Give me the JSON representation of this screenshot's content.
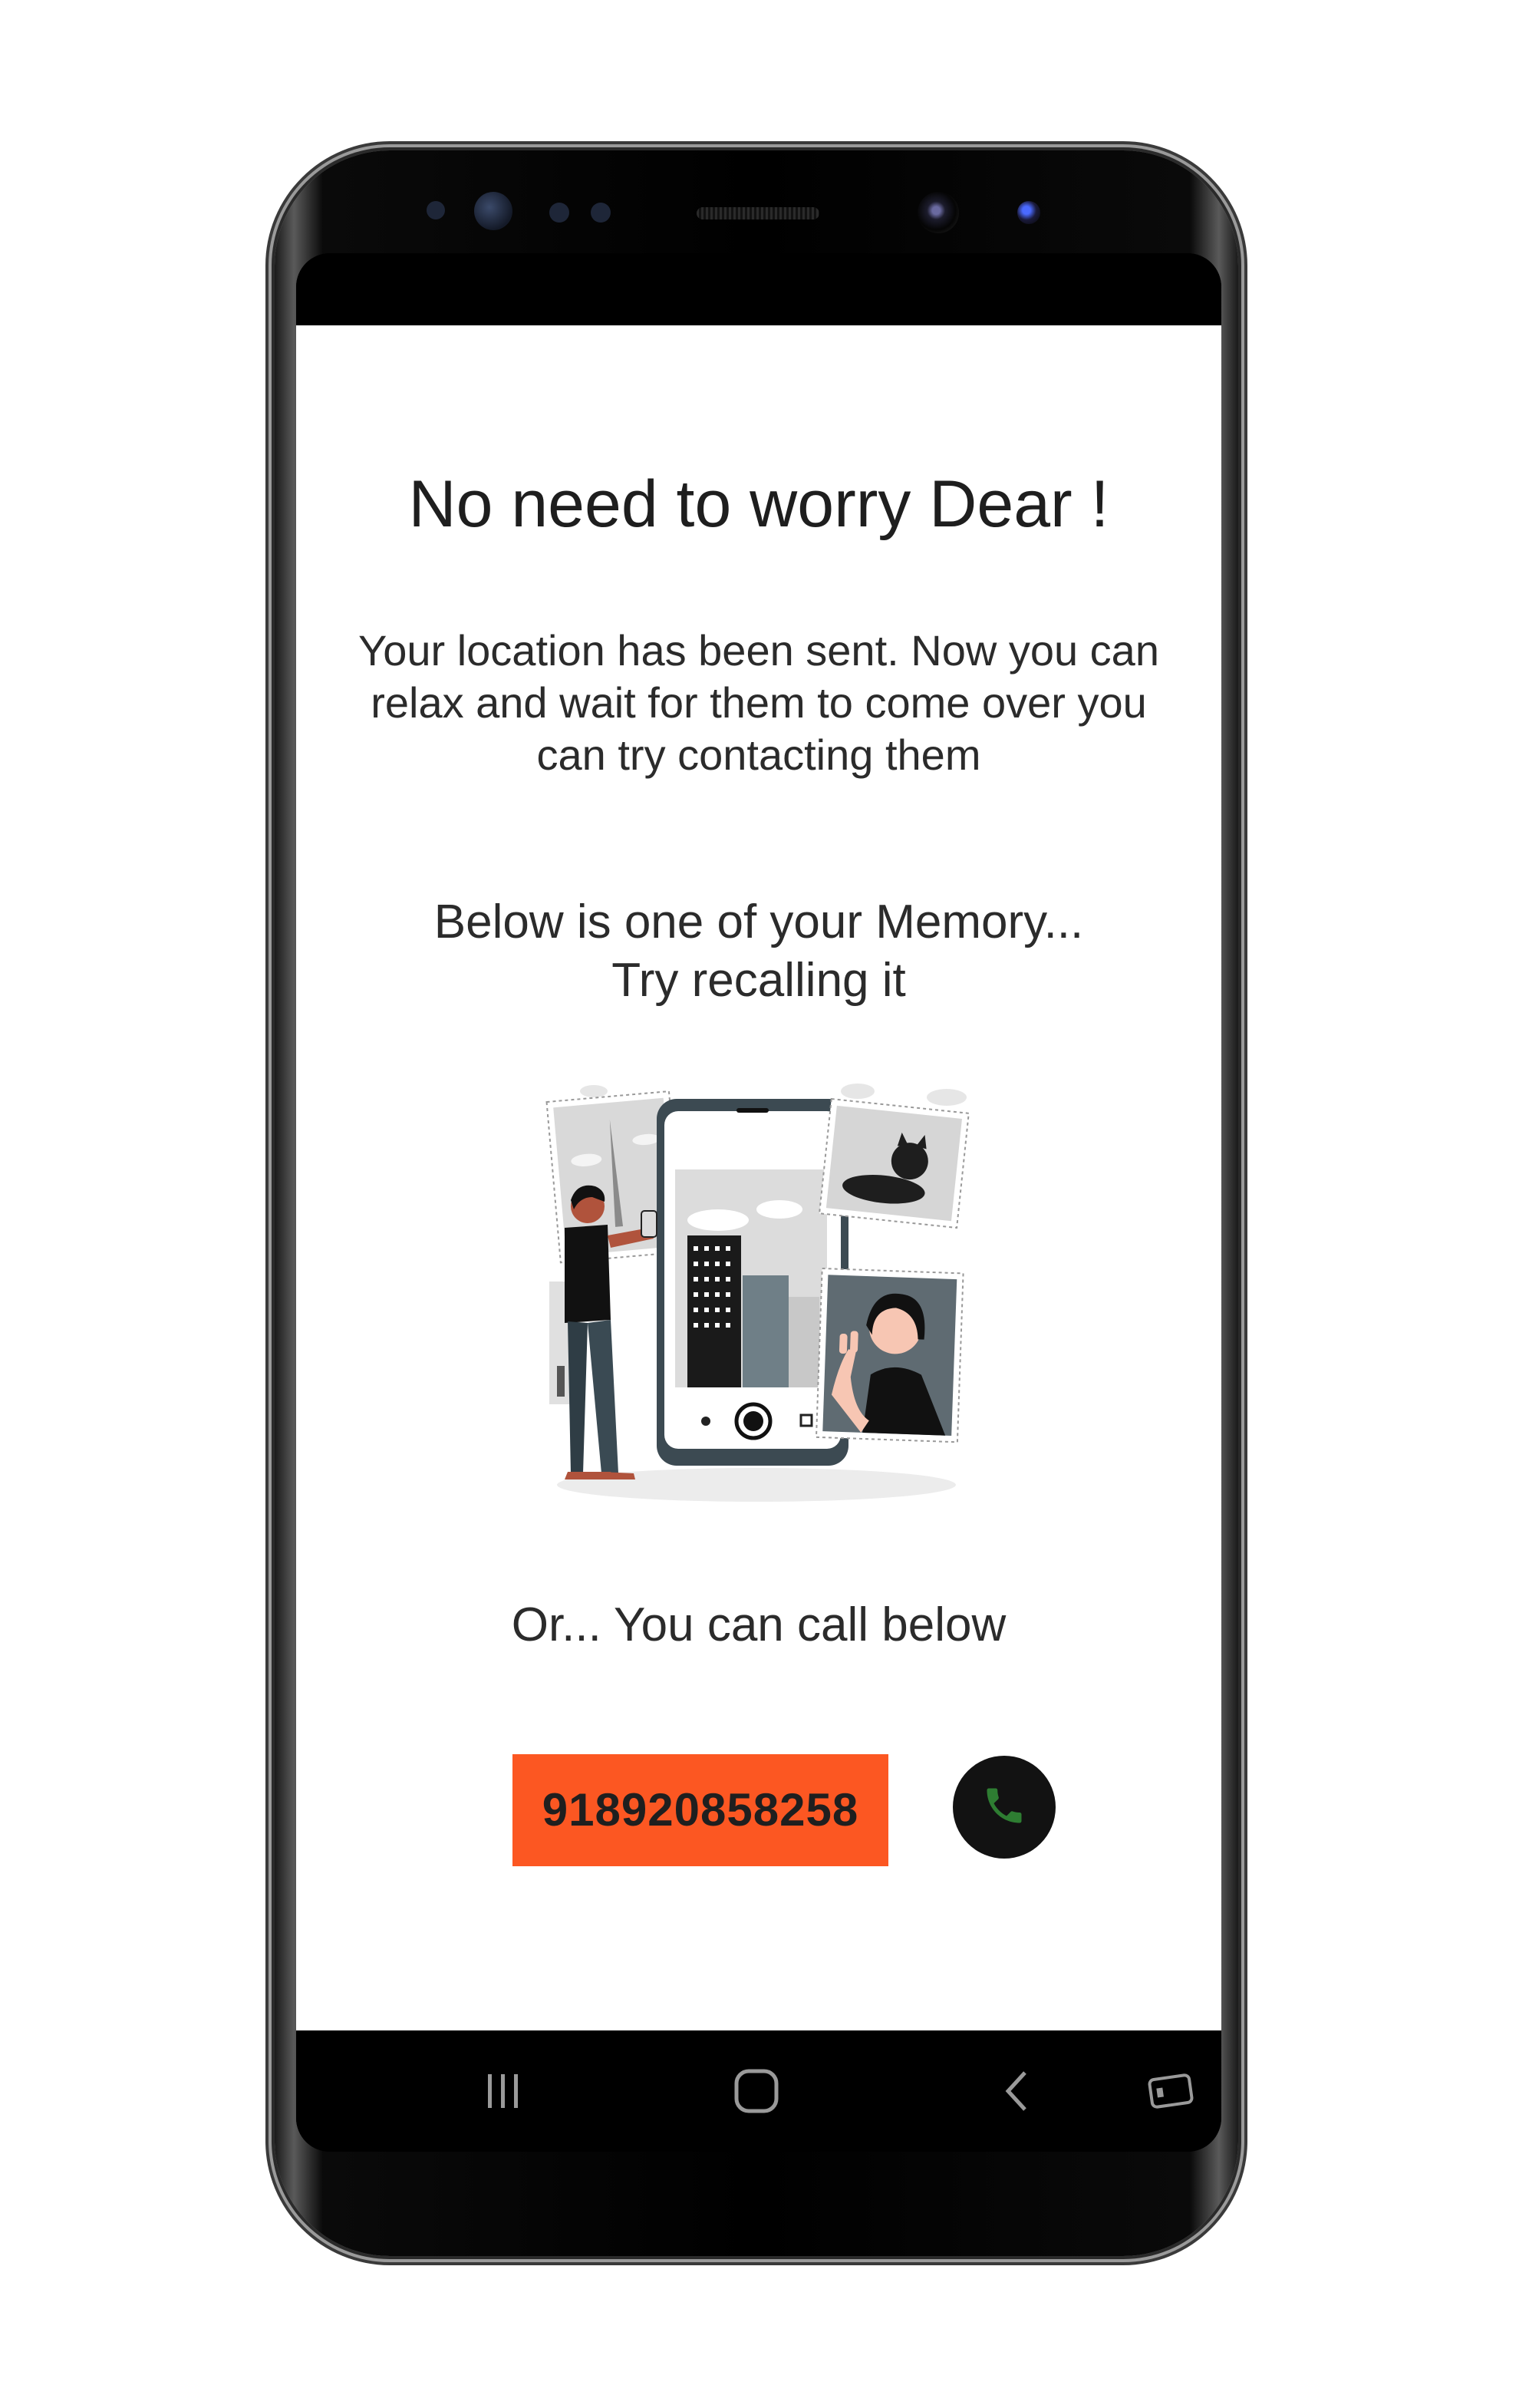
{
  "screen": {
    "title": "No need to worry Dear !",
    "message": "Your location has been sent. Now you can relax and wait for them to come over you can try contacting them",
    "memory_line1": "Below is one of your Memory...",
    "memory_line2": "Try recalling it",
    "memory_image_icon": "memory-illustration",
    "call_prompt": "Or... You can call below",
    "phone_number": "918920858258",
    "call_icon": "phone-icon"
  },
  "navbar": {
    "recent_icon": "recent-apps-icon",
    "home_icon": "home-icon",
    "back_icon": "back-icon",
    "extra_icon": "rotate-screen-icon"
  },
  "colors": {
    "accent": "#fc5722",
    "call_button_bg": "#121212",
    "call_icon": "#2e7d32",
    "text": "#2b2b2b"
  }
}
